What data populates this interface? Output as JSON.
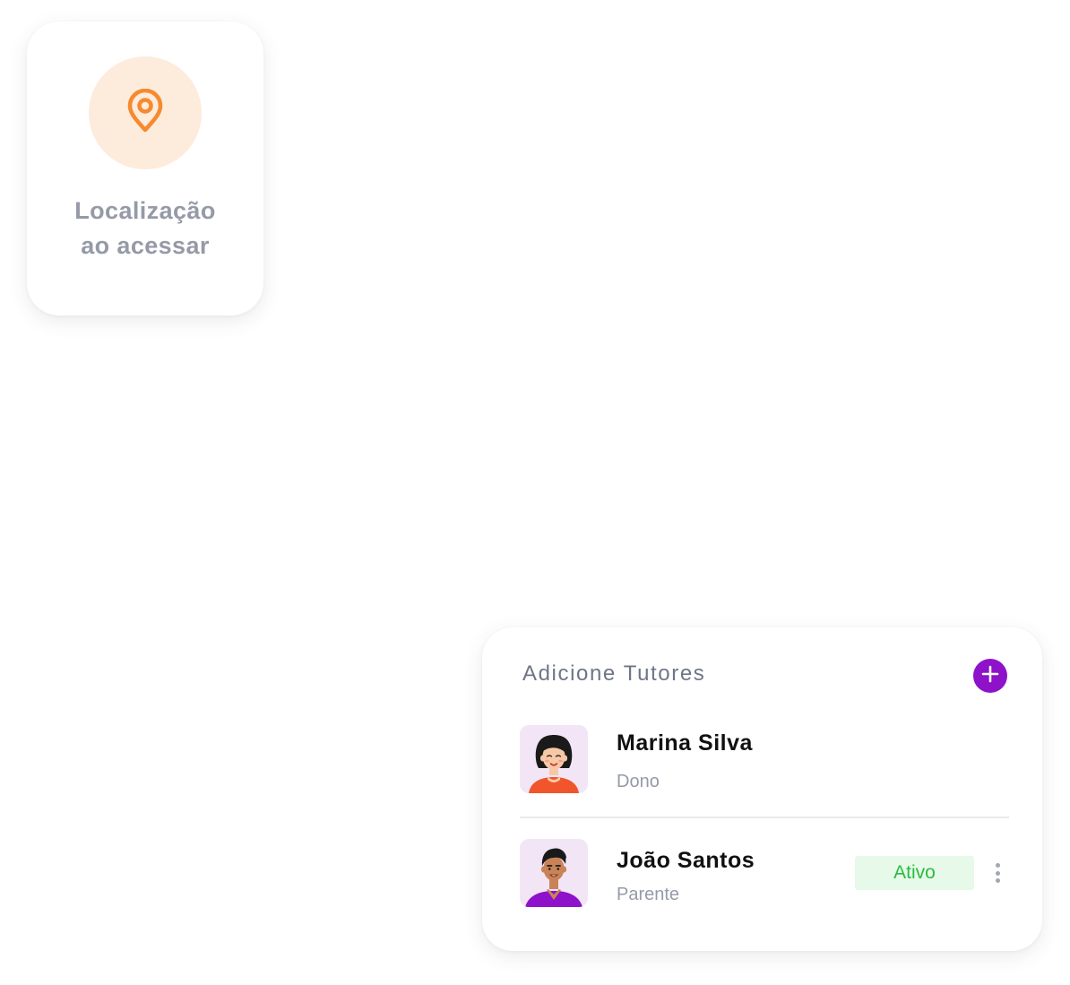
{
  "location_card": {
    "icon": "map-pin-icon",
    "label_line1": "Localização",
    "label_line2": "ao acessar",
    "accent_color": "#f58a2f",
    "icon_bg_color": "#fdebdc"
  },
  "tutors_card": {
    "title": "Adicione Tutores",
    "add_button_icon": "plus-icon",
    "add_button_color": "#8d12c9",
    "tutors": [
      {
        "name": "Marina Silva",
        "role": "Dono",
        "avatar": "female-avatar"
      },
      {
        "name": "João Santos",
        "role": "Parente",
        "avatar": "male-avatar",
        "status": "Ativo",
        "status_color": "#2bbb43",
        "menu_icon": "more-vertical-icon"
      }
    ]
  }
}
